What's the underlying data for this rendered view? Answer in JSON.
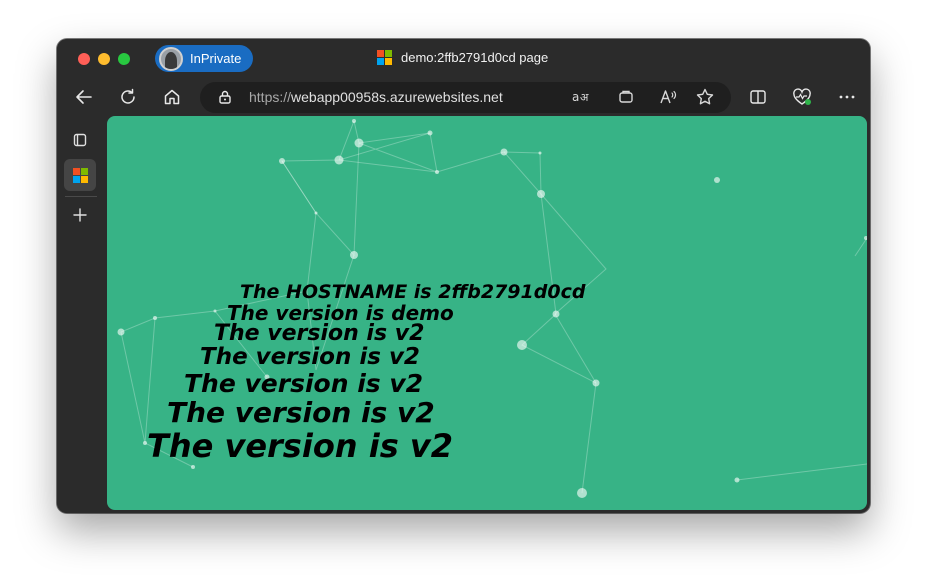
{
  "browser": {
    "inprivate_label": "InPrivate",
    "tab_title": "demo:2ffb2791d0cd page",
    "address": {
      "protocol": "https://",
      "host": "webapp00958s.azurewebsites.net"
    },
    "colors": {
      "inprivate_badge": "#1a6cc2",
      "page_background": "#37b386"
    },
    "toolbar_icons": [
      "back-arrow-icon",
      "refresh-icon",
      "home-icon",
      "lock-icon",
      "translate-icon",
      "app-available-icon",
      "read-aloud-icon",
      "favorite-star-icon",
      "split-screen-icon",
      "browser-essentials-icon",
      "more-menu-icon"
    ],
    "sidebar_icons": [
      "tab-actions-icon",
      "microsoft-tab-icon",
      "new-tab-plus-icon"
    ]
  },
  "page": {
    "lines": [
      "The HOSTNAME is 2ffb2791d0cd",
      "The version is demo",
      "The version is v2",
      "The version is v2",
      "The version is v2",
      "The version is v2",
      "The version is v2"
    ]
  }
}
